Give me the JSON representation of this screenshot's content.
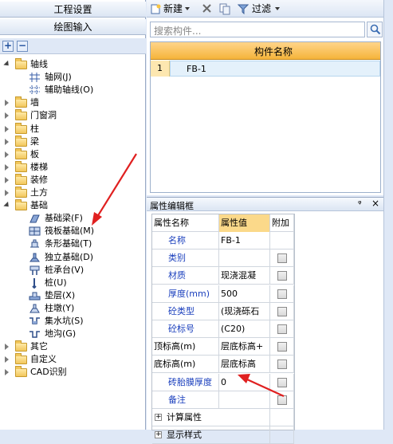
{
  "left_panel": {
    "btn_project": "工程设置",
    "btn_draw": "绘图输入",
    "expand_all": "+",
    "collapse_all": "−",
    "tree": [
      {
        "label": "轴线",
        "level": 0,
        "state": "open"
      },
      {
        "label": "轴网(J)",
        "level": 1,
        "icon": "grid-axis"
      },
      {
        "label": "辅助轴线(O)",
        "level": 1,
        "icon": "aux-axis"
      },
      {
        "label": "墙",
        "level": 0,
        "state": "closed"
      },
      {
        "label": "门窗洞",
        "level": 0,
        "state": "closed"
      },
      {
        "label": "柱",
        "level": 0,
        "state": "closed"
      },
      {
        "label": "梁",
        "level": 0,
        "state": "closed"
      },
      {
        "label": "板",
        "level": 0,
        "state": "closed"
      },
      {
        "label": "楼梯",
        "level": 0,
        "state": "closed"
      },
      {
        "label": "装修",
        "level": 0,
        "state": "closed"
      },
      {
        "label": "土方",
        "level": 0,
        "state": "closed"
      },
      {
        "label": "基础",
        "level": 0,
        "state": "open"
      },
      {
        "label": "基础梁(F)",
        "level": 1,
        "icon": "foundation-beam"
      },
      {
        "label": "筏板基础(M)",
        "level": 1,
        "icon": "raft-foundation"
      },
      {
        "label": "条形基础(T)",
        "level": 1,
        "icon": "strip-foundation"
      },
      {
        "label": "独立基础(D)",
        "level": 1,
        "icon": "isolated-foundation"
      },
      {
        "label": "桩承台(V)",
        "level": 1,
        "icon": "pile-cap"
      },
      {
        "label": "桩(U)",
        "level": 1,
        "icon": "pile"
      },
      {
        "label": "垫层(X)",
        "level": 1,
        "icon": "cushion"
      },
      {
        "label": "柱墩(Y)",
        "level": 1,
        "icon": "column-pier"
      },
      {
        "label": "集水坑(S)",
        "level": 1,
        "icon": "sump-pit"
      },
      {
        "label": "地沟(G)",
        "level": 1,
        "icon": "trench"
      },
      {
        "label": "其它",
        "level": 0,
        "state": "closed"
      },
      {
        "label": "自定义",
        "level": 0,
        "state": "closed"
      },
      {
        "label": "CAD识别",
        "level": 0,
        "state": "closed"
      }
    ]
  },
  "toolbar": {
    "new_label": "新建",
    "filter_label": "过滤"
  },
  "search": {
    "placeholder": "搜索构件..."
  },
  "component_grid": {
    "header": "构件名称",
    "rows": [
      {
        "num": "1",
        "name": "FB-1"
      }
    ]
  },
  "property_panel": {
    "title": "属性编辑框",
    "pin": "ᵠ",
    "close": "×",
    "headers": {
      "name": "属性名称",
      "value": "属性值",
      "extra": "附加"
    },
    "rows": [
      {
        "name": "名称",
        "value": "FB-1",
        "checkbox": false,
        "blue": true
      },
      {
        "name": "类别",
        "value": "",
        "checkbox": true,
        "blue": true
      },
      {
        "name": "材质",
        "value": "现浇混凝",
        "checkbox": true,
        "blue": true
      },
      {
        "name": "厚度(mm)",
        "value": "500",
        "checkbox": true,
        "blue": true
      },
      {
        "name": "砼类型",
        "value": "(现浇砾石",
        "checkbox": true,
        "blue": true
      },
      {
        "name": "砼标号",
        "value": "(C20)",
        "checkbox": true,
        "blue": true
      },
      {
        "name": "顶标高(m)",
        "value": "层底标高+",
        "checkbox": true,
        "blue": false
      },
      {
        "name": "底标高(m)",
        "value": "层底标高",
        "checkbox": true,
        "blue": false
      },
      {
        "name": "砖胎膜厚度",
        "value": "0",
        "checkbox": true,
        "blue": true
      },
      {
        "name": "备注",
        "value": "",
        "checkbox": true,
        "blue": true
      }
    ],
    "groups": [
      "计算属性",
      "显示样式"
    ]
  },
  "colors": {
    "header_orange": "#f5b43b",
    "arrow_red": "#e02020",
    "prop_blue": "#1a3fbd"
  }
}
